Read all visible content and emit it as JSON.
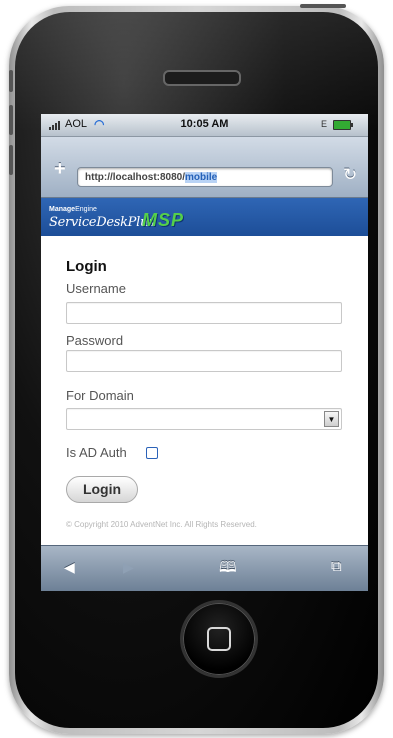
{
  "status_bar": {
    "carrier": "AOL",
    "time": "10:05 AM",
    "network": "E"
  },
  "browser": {
    "url_prefix": "http://localhost:8080/",
    "url_selected": "mobile"
  },
  "brand": {
    "manage_engine_bold": "Manage",
    "manage_engine_rest": "Engine",
    "product": "ServiceDeskPlus",
    "edition": "MSP"
  },
  "login": {
    "title": "Login",
    "username_label": "Username",
    "username_value": "",
    "password_label": "Password",
    "password_value": "",
    "domain_label": "For Domain",
    "domain_value": "",
    "ad_auth_label": "Is AD Auth",
    "ad_auth_checked": false,
    "button_label": "Login"
  },
  "footer": {
    "copyright": "© Copyright 2010 AdventNet Inc. All Rights Reserved."
  },
  "toolbar_icons": [
    "back-icon",
    "forward-icon",
    "bookmarks-icon",
    "pages-icon"
  ]
}
